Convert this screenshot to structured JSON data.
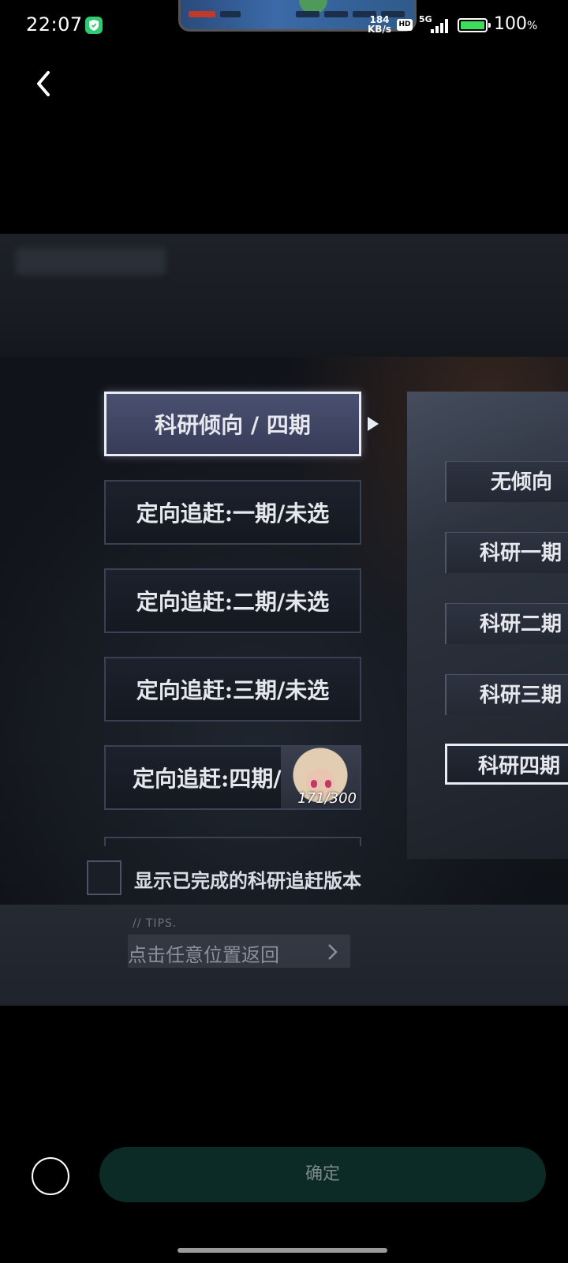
{
  "status_bar": {
    "time": "22:07",
    "net_speed_value": "184",
    "net_speed_unit": "KB/s",
    "hd_label": "HD",
    "network_label": "5G",
    "battery_percent": "100",
    "battery_percent_sign": "%",
    "battery_level": 1.0
  },
  "game": {
    "left_list": [
      {
        "label": "科研倾向 / 四期",
        "selected": true
      },
      {
        "label": "定向追赶:一期/未选",
        "selected": false
      },
      {
        "label": "定向追赶:二期/未选",
        "selected": false
      },
      {
        "label": "定向追赶:三期/未选",
        "selected": false
      },
      {
        "label": "定向追赶:四期/选",
        "selected": false,
        "progress": "171/300"
      }
    ],
    "right_options": [
      {
        "label": "无倾向",
        "selected": false
      },
      {
        "label": "科研一期",
        "selected": false
      },
      {
        "label": "科研二期",
        "selected": false
      },
      {
        "label": "科研三期",
        "selected": false
      },
      {
        "label": "科研四期",
        "selected": true
      }
    ],
    "checkbox_label": "显示已完成的科研追赶版本",
    "checkbox_checked": false,
    "tips_header": "// TIPS.",
    "tips_text": "点击任意位置返回"
  },
  "bottom": {
    "confirm_label": "确定"
  },
  "colors": {
    "confirm_bg": "#0d2b26",
    "battery_fill": "#3ddc5a",
    "shield_icon": "#2ecc71"
  }
}
